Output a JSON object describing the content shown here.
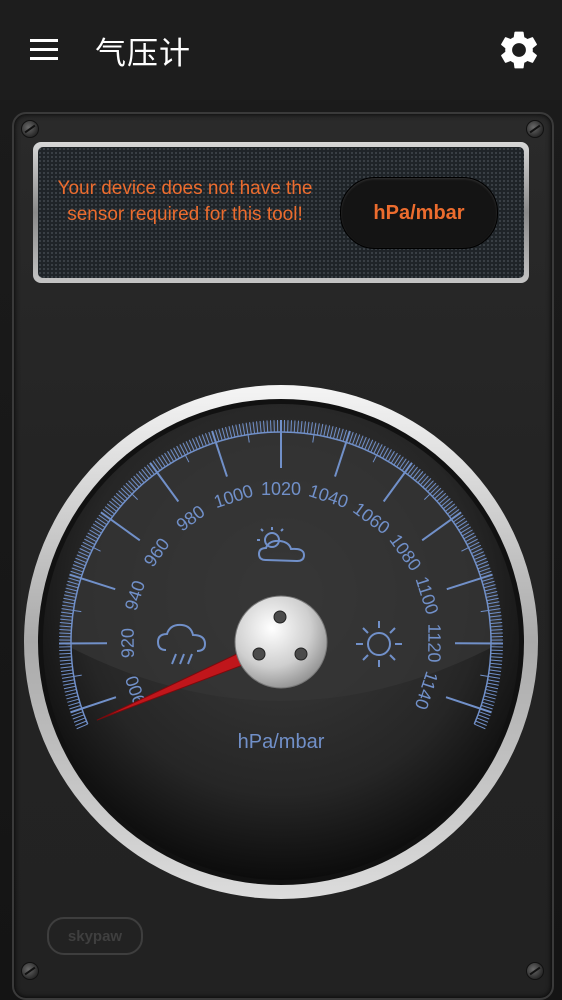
{
  "app": {
    "title": "气压计"
  },
  "icons": {
    "menu": "hamburger-menu-icon",
    "settings": "gear-icon",
    "weather_left": "rain-cloud-icon",
    "weather_top": "sun-behind-cloud-icon",
    "weather_right": "sun-icon"
  },
  "alert": {
    "message": "Your device does not have the sensor required for this tool!",
    "unit_button_label": "hPa/mbar"
  },
  "gauge": {
    "unit_label": "hPa/mbar",
    "scale_labels": [
      "900",
      "920",
      "940",
      "960",
      "980",
      "1000",
      "1020",
      "1040",
      "1060",
      "1080",
      "1100",
      "1120",
      "1140"
    ],
    "scale_min": 895,
    "scale_max": 1145,
    "needle_value": 895,
    "accent_color": "#7190c9",
    "needle_color": "#c0161b",
    "text_color": "#ec6c2e"
  },
  "brand": {
    "logo_text": "skypaw"
  }
}
